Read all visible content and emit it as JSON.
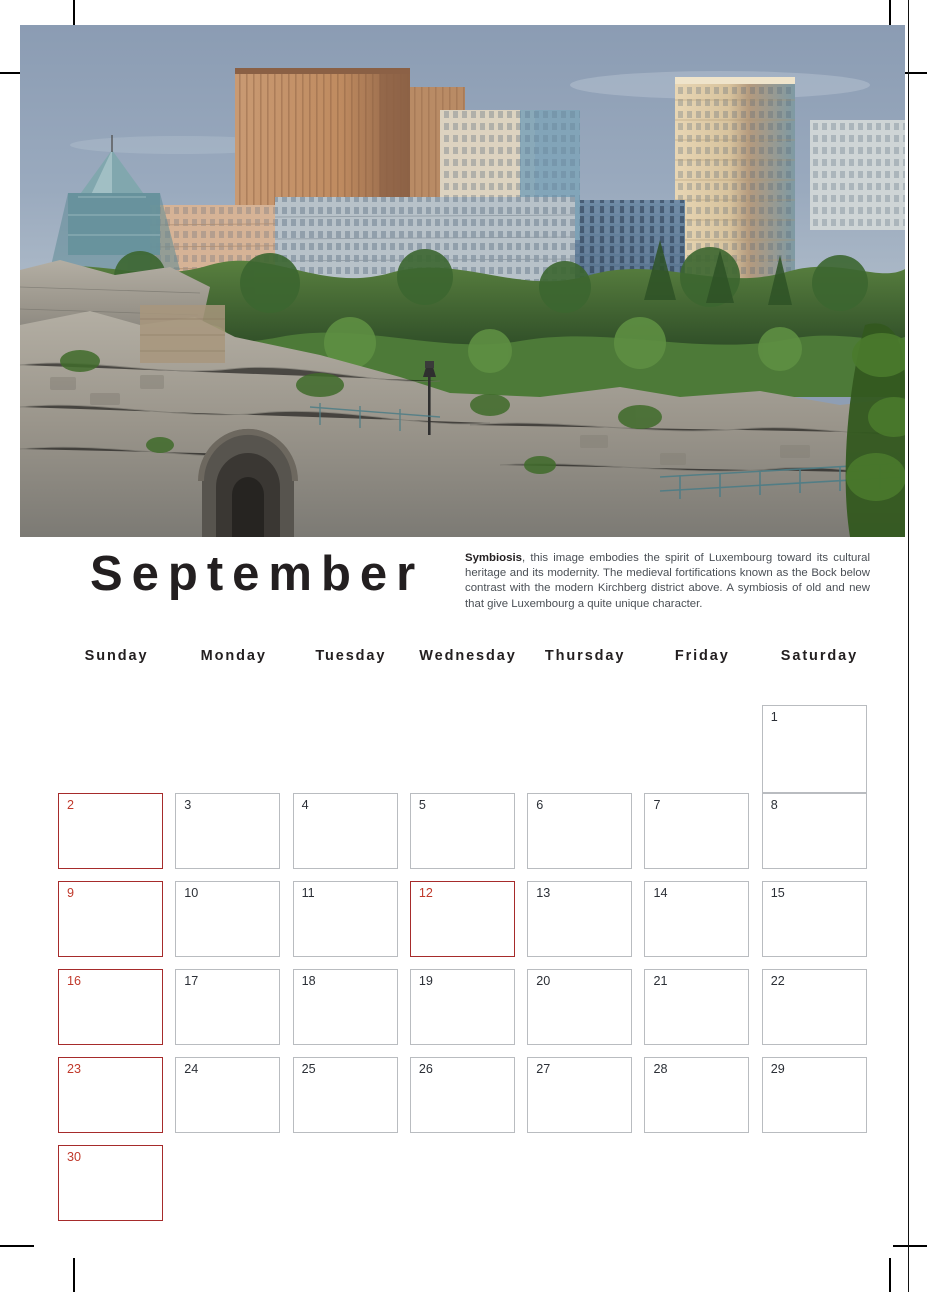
{
  "page": {
    "month_title": "September",
    "background": "#ffffff"
  },
  "photo": {
    "caption_subject": "Luxembourg Kirchberg district above the Bock casemates",
    "sky_color": "#8e9eb4",
    "accent_copper": "#c08a62",
    "accent_glass": "#6f8ea6",
    "rock_color": "#9a9791",
    "foliage_color": "#3f6b35"
  },
  "blurb": {
    "lead": "Symbiosis",
    "text": ", this image embodies the spirit of Luxembourg toward its cultural heritage and its modernity. The medieval fortifications known as the Bock below contrast with the modern Kirchberg district above. A symbiosis of old and new that give Luxembourg a quite unique character."
  },
  "weekdays": [
    "Sunday",
    "Monday",
    "Tuesday",
    "Wednesday",
    "Thursday",
    "Friday",
    "Saturday"
  ],
  "colors": {
    "red_accent": "#c0392b",
    "red_border": "#a62b2b",
    "cell_border": "#b9bcc0",
    "text_dark": "#231f20",
    "text_body": "#4a4f55"
  },
  "calendar": {
    "month": "September",
    "first_day_column": 6,
    "days_in_month": 30,
    "weeks": [
      [
        {
          "label": "",
          "blank": true
        },
        {
          "label": "",
          "blank": true
        },
        {
          "label": "",
          "blank": true
        },
        {
          "label": "",
          "blank": true
        },
        {
          "label": "",
          "blank": true
        },
        {
          "label": "",
          "blank": true
        },
        {
          "label": "1",
          "highlight": false,
          "tall": true
        }
      ],
      [
        {
          "label": "2",
          "highlight": true
        },
        {
          "label": "3",
          "highlight": false
        },
        {
          "label": "4",
          "highlight": false
        },
        {
          "label": "5",
          "highlight": false
        },
        {
          "label": "6",
          "highlight": false
        },
        {
          "label": "7",
          "highlight": false
        },
        {
          "label": "8",
          "highlight": false
        }
      ],
      [
        {
          "label": "9",
          "highlight": true
        },
        {
          "label": "10",
          "highlight": false
        },
        {
          "label": "11",
          "highlight": false
        },
        {
          "label": "12",
          "highlight": true
        },
        {
          "label": "13",
          "highlight": false
        },
        {
          "label": "14",
          "highlight": false
        },
        {
          "label": "15",
          "highlight": false
        }
      ],
      [
        {
          "label": "16",
          "highlight": true
        },
        {
          "label": "17",
          "highlight": false
        },
        {
          "label": "18",
          "highlight": false
        },
        {
          "label": "19",
          "highlight": false
        },
        {
          "label": "20",
          "highlight": false
        },
        {
          "label": "21",
          "highlight": false
        },
        {
          "label": "22",
          "highlight": false
        }
      ],
      [
        {
          "label": "23",
          "highlight": true
        },
        {
          "label": "24",
          "highlight": false
        },
        {
          "label": "25",
          "highlight": false
        },
        {
          "label": "26",
          "highlight": false
        },
        {
          "label": "27",
          "highlight": false
        },
        {
          "label": "28",
          "highlight": false
        },
        {
          "label": "29",
          "highlight": false
        }
      ],
      [
        {
          "label": "30",
          "highlight": true
        },
        {
          "label": "",
          "blank": true
        },
        {
          "label": "",
          "blank": true
        },
        {
          "label": "",
          "blank": true
        },
        {
          "label": "",
          "blank": true
        },
        {
          "label": "",
          "blank": true
        },
        {
          "label": "",
          "blank": true
        }
      ]
    ]
  }
}
